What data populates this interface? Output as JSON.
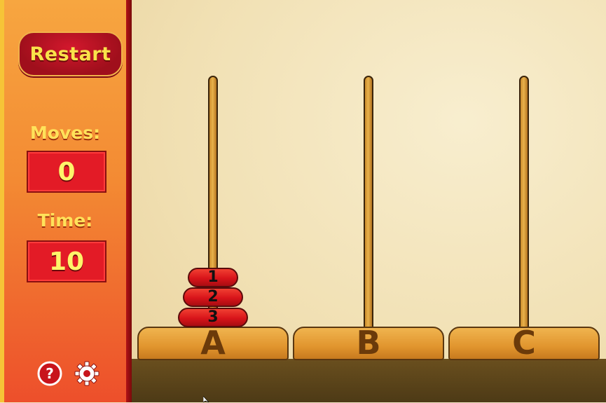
{
  "panel": {
    "restart_label": "Restart",
    "moves_label": "Moves:",
    "moves_value": "0",
    "time_label": "Time:",
    "time_value": "10",
    "help_icon": "help-icon",
    "settings_icon": "gear-icon"
  },
  "game": {
    "pegs": [
      {
        "label": "A",
        "disks": [
          "1",
          "2",
          "3"
        ]
      },
      {
        "label": "B",
        "disks": []
      },
      {
        "label": "C",
        "disks": []
      }
    ]
  },
  "colors": {
    "disk": "#d8141a",
    "peg": "#e1952e",
    "panel_top": "#f7a640",
    "panel_bottom": "#ed4f2b",
    "text_yellow": "#ffe25a"
  }
}
